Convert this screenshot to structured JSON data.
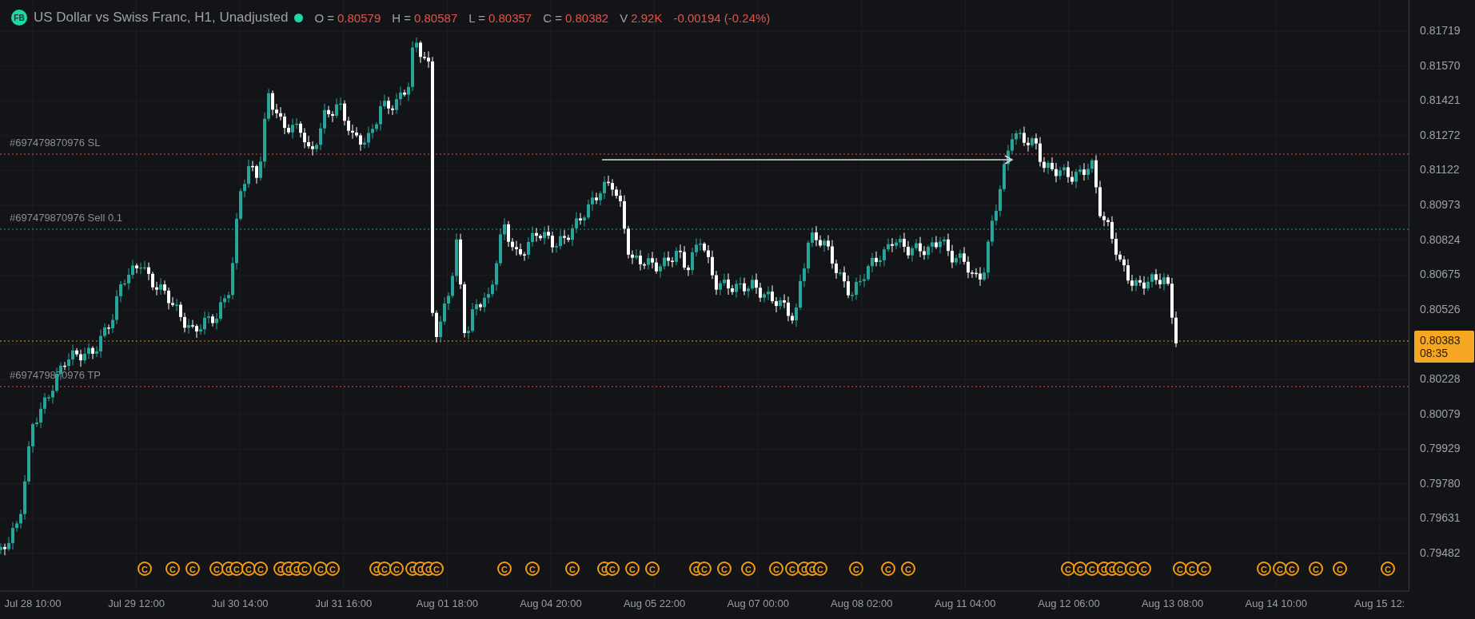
{
  "header": {
    "logo": "FB",
    "title": "US Dollar vs Swiss Franc, H1, Unadjusted",
    "live": true,
    "stats": [
      {
        "label": "O =",
        "value": "0.80579"
      },
      {
        "label": "H =",
        "value": "0.80587"
      },
      {
        "label": "L =",
        "value": "0.80357"
      },
      {
        "label": "C =",
        "value": "0.80382"
      },
      {
        "label": "V",
        "value": "2.92K"
      }
    ],
    "change": "-0.00194 (-0.24%)"
  },
  "order_lines": [
    {
      "kind": "sl",
      "label": "#697479870976 SL"
    },
    {
      "kind": "entry",
      "label": "#697479870976 Sell 0.1"
    },
    {
      "kind": "tp",
      "label": "#697479870976 TP"
    }
  ],
  "price_axis": {
    "ticks": [
      "0.81719",
      "0.81570",
      "0.81421",
      "0.81272",
      "0.81122",
      "0.80973",
      "0.80824",
      "0.80675",
      "0.80526",
      "0.80228",
      "0.80079",
      "0.79929",
      "0.79780",
      "0.79631",
      "0.79482"
    ],
    "current": {
      "price": "0.80383",
      "countdown": "08:35"
    }
  },
  "time_axis": [
    "Jul 28 10:00",
    "Jul 29 12:00",
    "Jul 30 14:00",
    "Jul 31 16:00",
    "Aug 01 18:00",
    "Aug 04 20:00",
    "Aug 05 22:00",
    "Aug 07 00:00",
    "Aug 08 02:00",
    "Aug 11 04:00",
    "Aug 12 06:00",
    "Aug 13 08:00",
    "Aug 14 10:00",
    "Aug 15 12:"
  ],
  "events": [
    "C",
    "C",
    "C",
    "C",
    "C",
    "C",
    "C",
    "C",
    "C",
    "C",
    "C",
    "C",
    "C",
    "C",
    "C",
    "C",
    "C",
    "C",
    "C",
    "C",
    "C",
    "C",
    "C",
    "C",
    "C",
    "C",
    "C",
    "C",
    "C",
    "C",
    "C",
    "C",
    "C",
    "C",
    "C",
    "C",
    "C",
    "C",
    "C",
    "C",
    "C",
    "C",
    "C",
    "C",
    "C",
    "C",
    "C",
    "C",
    "C",
    "C",
    "C",
    "C",
    "C",
    "C",
    "C",
    "C",
    "C"
  ]
}
